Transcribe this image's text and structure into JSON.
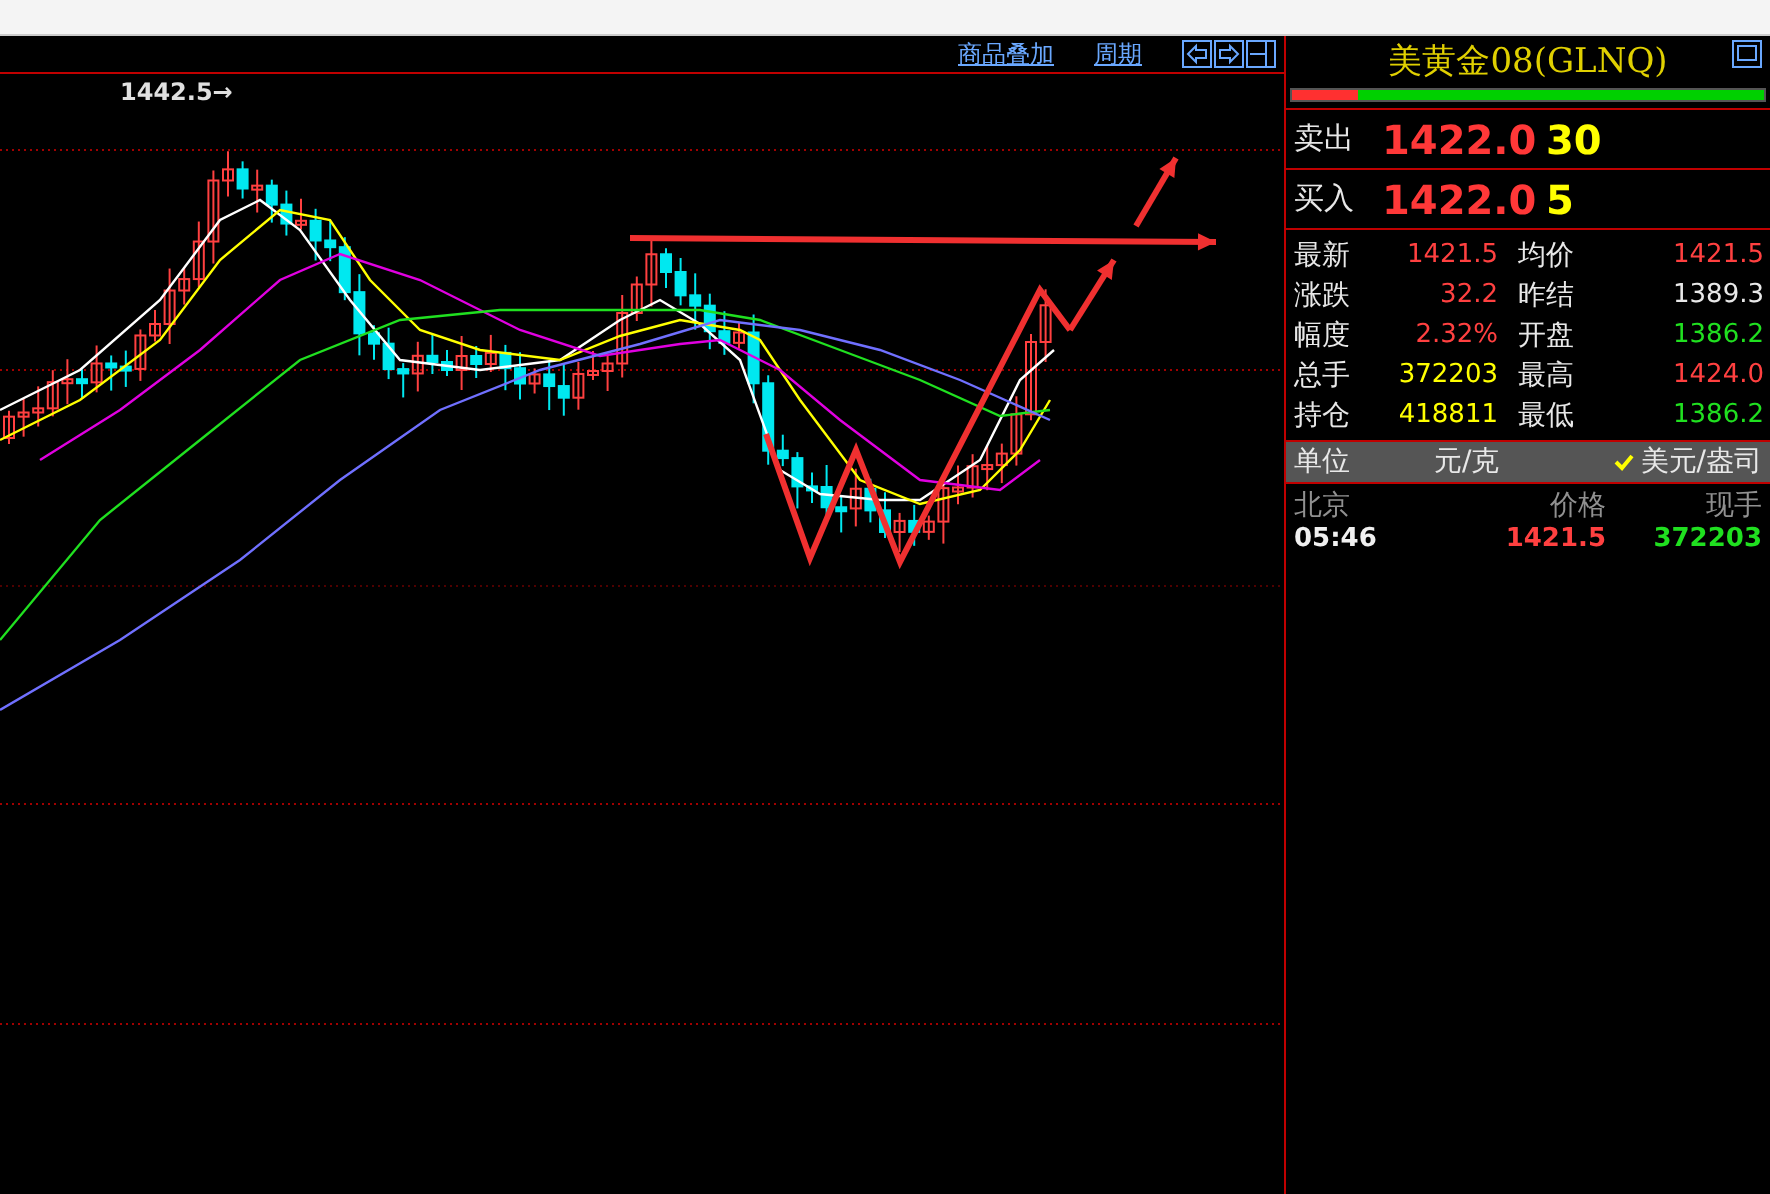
{
  "chart": {
    "links": [
      {
        "label": "商品叠加"
      },
      {
        "label": "周期"
      }
    ],
    "high_label": "1442.5→"
  },
  "quote_panel": {
    "title": "美黄金08(GLNQ)",
    "ratio_bar": {
      "level": 0.14
    },
    "depth": [
      {
        "label": "卖出",
        "price": "1422.0",
        "volume": "30"
      },
      {
        "label": "买入",
        "price": "1422.0",
        "volume": "5"
      }
    ],
    "stats": [
      {
        "label": "最新",
        "value": "1421.5",
        "color": "#ff4040"
      },
      {
        "label": "均价",
        "value": "1421.5",
        "color": "#ff4040"
      },
      {
        "label": "涨跌",
        "value": "32.2",
        "color": "#ff4040"
      },
      {
        "label": "昨结",
        "value": "1389.3",
        "color": "#e8e8e8"
      },
      {
        "label": "幅度",
        "value": "2.32%",
        "color": "#ff4040"
      },
      {
        "label": "开盘",
        "value": "1386.2",
        "color": "#20e020"
      },
      {
        "label": "总手",
        "value": "372203",
        "color": "#ffff00"
      },
      {
        "label": "最高",
        "value": "1424.0",
        "color": "#ff4040"
      },
      {
        "label": "持仓",
        "value": "418811",
        "color": "#ffff00"
      },
      {
        "label": "最低",
        "value": "1386.2",
        "color": "#20e020"
      }
    ],
    "unit": {
      "label": "单位",
      "options": [
        {
          "label": "元/克",
          "selected": false
        },
        {
          "label": "美元/盎司",
          "selected": true
        }
      ]
    },
    "ticks": {
      "columns": [
        "北京",
        "价格",
        "现手"
      ],
      "rows": [
        {
          "time": "05:46",
          "price": "1421.5",
          "volume": "372203"
        }
      ]
    }
  }
}
